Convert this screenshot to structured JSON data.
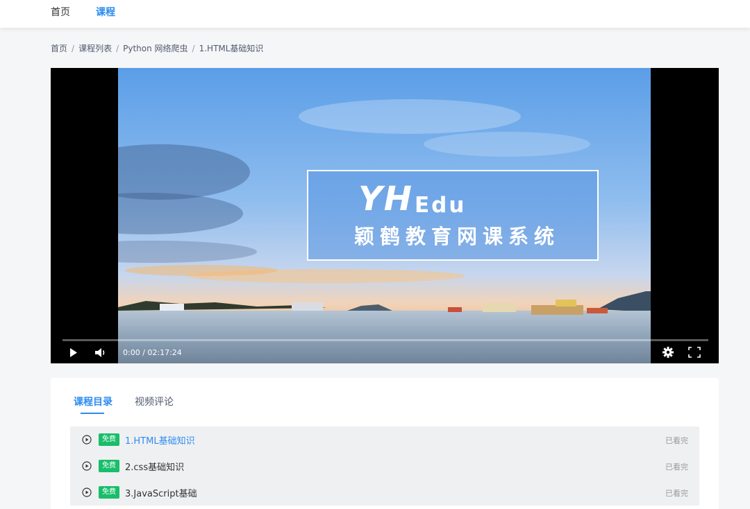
{
  "nav": {
    "items": [
      {
        "label": "首页",
        "active": false
      },
      {
        "label": "课程",
        "active": true
      }
    ]
  },
  "breadcrumb": {
    "items": [
      "首页",
      "课程列表",
      "Python 网络爬虫",
      "1.HTML基础知识"
    ],
    "separator": "/"
  },
  "player": {
    "poster": {
      "brand_mark": "YH",
      "brand_word": "Edu",
      "subtitle": "颖鹤教育网课系统"
    },
    "controls": {
      "time_display": "0:00 / 02:17:24",
      "play_icon": "play-icon",
      "volume_icon": "volume-icon",
      "settings_icon": "gear-icon",
      "fullscreen_icon": "fullscreen-icon"
    },
    "progress": 0
  },
  "tabs": [
    {
      "label": "课程目录",
      "active": true
    },
    {
      "label": "视频评论",
      "active": false
    }
  ],
  "lessons": [
    {
      "badge": "免费",
      "title": "1.HTML基础知识",
      "status": "已看完",
      "current": true
    },
    {
      "badge": "免费",
      "title": "2.css基础知识",
      "status": "已看完",
      "current": false
    },
    {
      "badge": "免费",
      "title": "3.JavaScript基础",
      "status": "已看完",
      "current": false
    }
  ],
  "colors": {
    "accent": "#2d8cf0",
    "free_badge": "#19be6b",
    "list_bg": "#eff0f2",
    "page_bg": "#f5f6f7"
  }
}
